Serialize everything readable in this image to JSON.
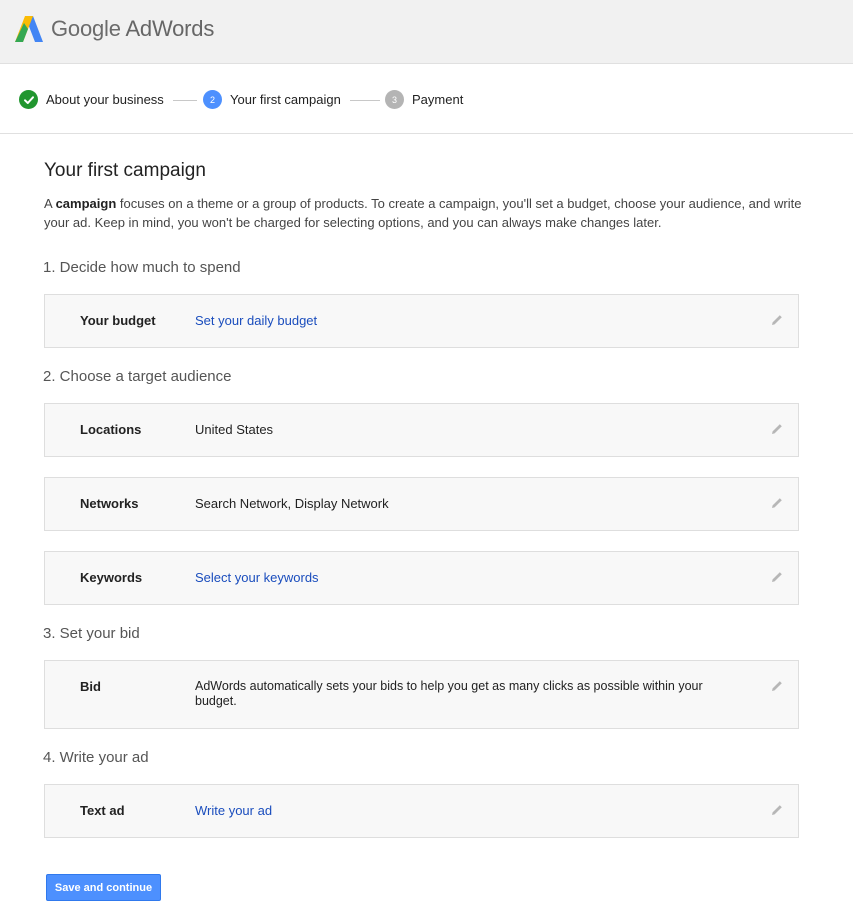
{
  "header": {
    "logo_icon": "google-adwords-logo",
    "brand_google": "Google",
    "brand_product": "AdWords"
  },
  "steps": [
    {
      "status": "complete",
      "marker": "",
      "label": "About your business"
    },
    {
      "status": "current",
      "marker": "2",
      "label": "Your first campaign"
    },
    {
      "status": "upcoming",
      "marker": "3",
      "label": "Payment"
    }
  ],
  "colors": {
    "step_complete": "#21962f",
    "step_current": "#4d90fe",
    "step_upcoming": "#b4b4b4",
    "link": "#1a4dbd",
    "button": "#4d90fe"
  },
  "page": {
    "title": "Your first campaign",
    "intro_prefix": "A ",
    "intro_bold": "campaign",
    "intro_rest": " focuses on a theme or a group of products. To create a campaign, you'll set a budget, choose your audience, and write your ad. Keep in mind, you won't be charged for selecting options, and you can always make changes later."
  },
  "sections": {
    "budget": {
      "heading": "1. Decide how much to spend",
      "label": "Your budget",
      "value": "Set your daily budget"
    },
    "audience": {
      "heading": "2. Choose a target audience",
      "locations_label": "Locations",
      "locations_value": "United States",
      "networks_label": "Networks",
      "networks_value": "Search Network, Display Network",
      "keywords_label": "Keywords",
      "keywords_value": "Select your keywords"
    },
    "bid": {
      "heading": "3. Set your bid",
      "label": "Bid",
      "value": "AdWords automatically sets your bids to help you get as many clicks as possible within your budget."
    },
    "ad": {
      "heading": "4. Write your ad",
      "label": "Text ad",
      "value": "Write your ad"
    }
  },
  "actions": {
    "save_label": "Save and continue"
  },
  "icons": {
    "edit": "pencil-icon",
    "check": "checkmark-icon"
  }
}
